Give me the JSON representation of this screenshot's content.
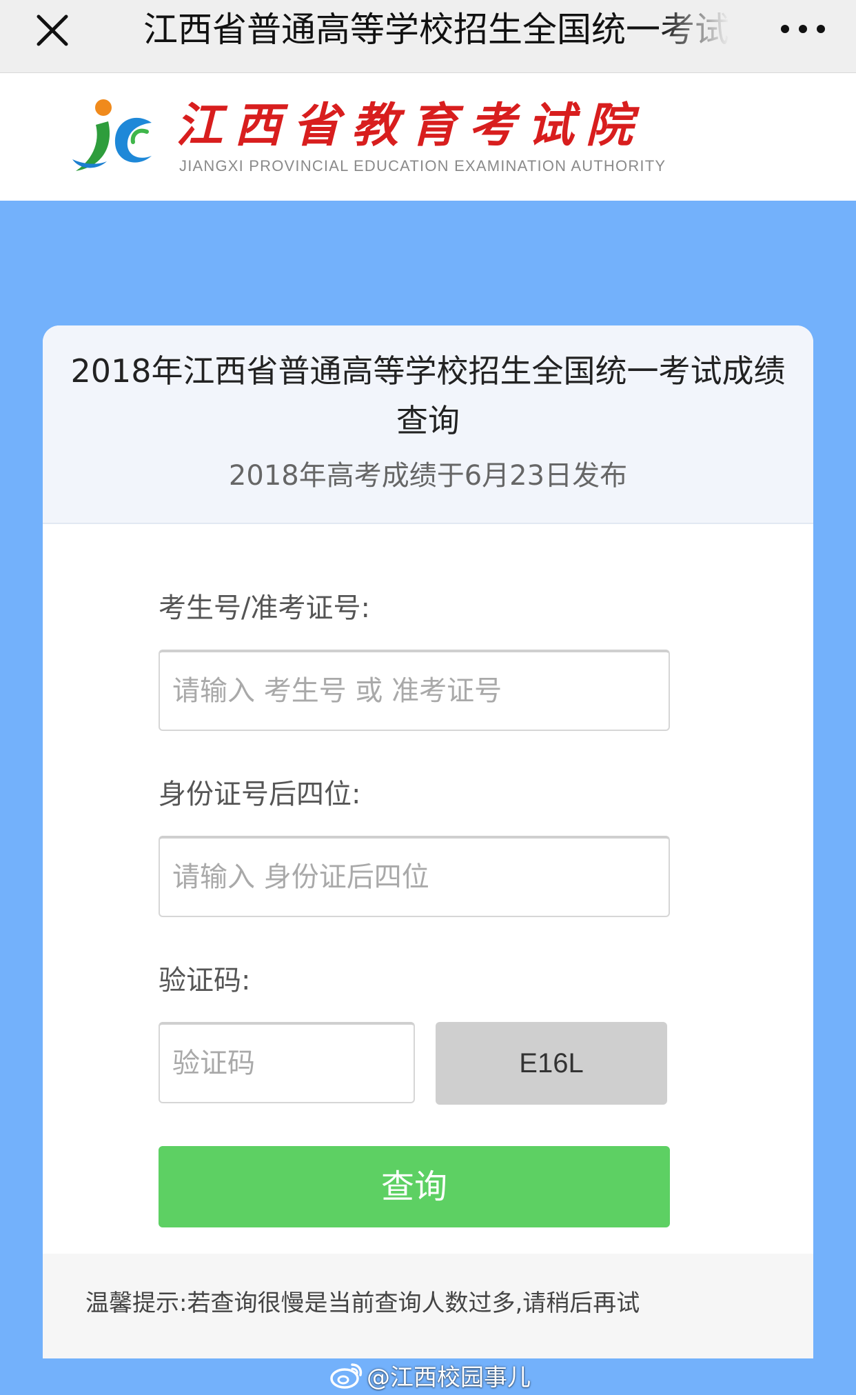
{
  "navbar": {
    "title": "江西省普通高等学校招生全国统一考试成绩查询",
    "close_icon": "close-icon",
    "more_icon": "more-dots-icon"
  },
  "header": {
    "logo_cn": "江西省教育考试院",
    "logo_en": "JIANGXI PROVINCIAL EDUCATION EXAMINATION AUTHORITY"
  },
  "card": {
    "title": "2018年江西省普通高等学校招生全国统一考试成绩查询",
    "subtitle": "2018年高考成绩于6月23日发布"
  },
  "form": {
    "exam_id_label": "考生号/准考证号:",
    "exam_id_placeholder": "请输入 考生号 或 准考证号",
    "exam_id_value": "",
    "id_last4_label": "身份证号后四位:",
    "id_last4_placeholder": "请输入 身份证后四位",
    "id_last4_value": "",
    "captcha_label": "验证码:",
    "captcha_placeholder": "验证码",
    "captcha_value": "",
    "captcha_code": "E16L",
    "submit_label": "查询"
  },
  "tip": {
    "text": "温馨提示:若查询很慢是当前查询人数过多,请稍后再试"
  },
  "watermark": {
    "text": "@江西校园事儿"
  },
  "colors": {
    "page_background": "#73b1fb",
    "logo_red": "#d81e1e",
    "submit_green": "#5dd063",
    "captcha_gray": "#cfcfcf"
  }
}
